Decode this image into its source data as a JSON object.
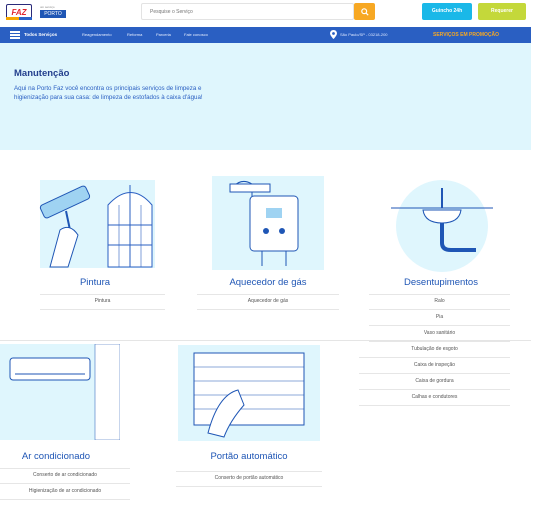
{
  "header": {
    "logo_text": "FAZ",
    "partner_small": "um serviço",
    "partner_badge": "PORTO",
    "search_placeholder": "Pesquise o Serviço",
    "quick_button": "Guincho 24h",
    "request_button": "Requerer"
  },
  "nav": {
    "all_services": "Todos Serviços",
    "links": [
      "Reagendamento",
      "Reforma",
      "Parceria",
      "Fale conosco"
    ],
    "location": "São Paulo/SP - 03218-200",
    "promo": "SERVIÇOS EM PROMOÇÃO"
  },
  "hero": {
    "title": "Manutenção",
    "description": "Aqui na Porto Faz você encontra os principais serviços de limpeza e higienização para sua casa: de limpeza de estofados à caixa d'água!"
  },
  "categories": [
    {
      "title": "Pintura",
      "items": [
        "Pintura"
      ]
    },
    {
      "title": "Aquecedor de gás",
      "items": [
        "Aquecedor de gás"
      ]
    },
    {
      "title": "Desentupimentos",
      "items": [
        "Ralo",
        "Pia",
        "Vaso sanitário",
        "Tubulação de esgoto",
        "Caixa de inspeção",
        "Caixa de gordura",
        "Calhas e condutores"
      ]
    },
    {
      "title": "Ar condicionado",
      "items": [
        "Conserto de ar condicionado",
        "Higienização de ar condicionado"
      ]
    },
    {
      "title": "Portão automático",
      "items": [
        "Conserto de portão automático"
      ]
    }
  ],
  "colors": {
    "brand_blue": "#2a5fc2",
    "hero_bg": "#dff6fd",
    "search_orange": "#f7a823",
    "quick_cyan": "#1ab8e8",
    "request_green": "#c4d83a"
  },
  "icons": [
    "search-icon",
    "menu-icon",
    "location-pin-icon"
  ]
}
